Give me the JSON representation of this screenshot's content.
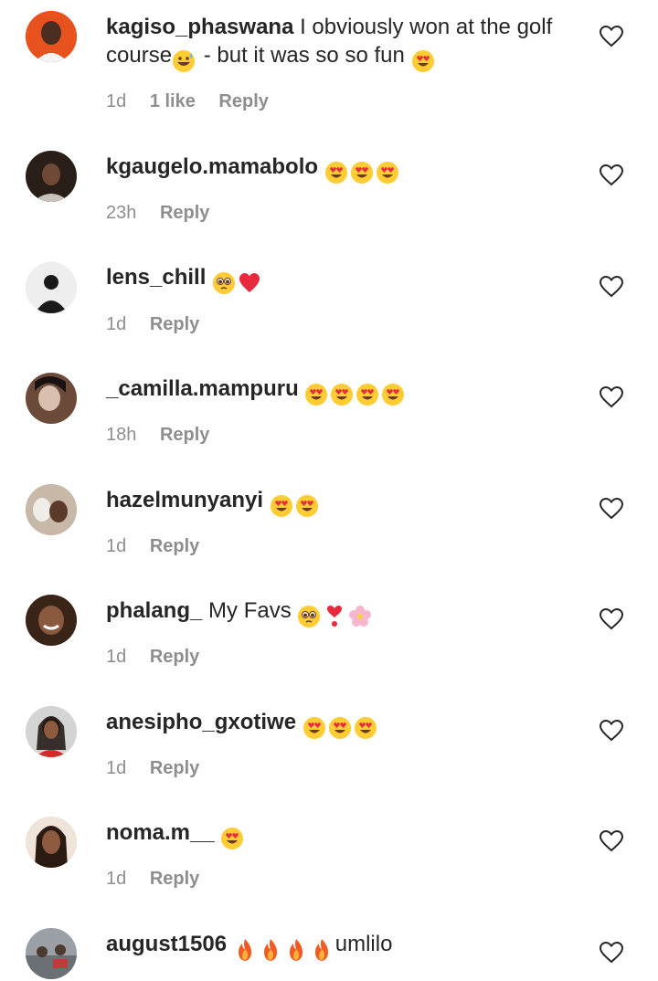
{
  "comments": [
    {
      "username": "kagiso_phaswana",
      "text_a": "I obviously won at the golf",
      "text_b": "course",
      "text_c": " - but it was so so fun",
      "time": "1d",
      "likes": "1 like",
      "reply": "Reply",
      "avatar_color": "#e8521f"
    },
    {
      "username": "kgaugelo.mamabolo",
      "text": "",
      "time": "23h",
      "reply": "Reply",
      "avatar_color": "#3a2b22"
    },
    {
      "username": "lens_chill",
      "text": "",
      "time": "1d",
      "reply": "Reply",
      "avatar_color": "#e8e8e8"
    },
    {
      "username": "_camilla.mampuru",
      "text": "",
      "time": "18h",
      "reply": "Reply",
      "avatar_color": "#6b4a3a"
    },
    {
      "username": "hazelmunyanyi",
      "text": "",
      "time": "1d",
      "reply": "Reply",
      "avatar_color": "#8a6a55"
    },
    {
      "username": "phalang_",
      "text": "My Favs",
      "time": "1d",
      "reply": "Reply",
      "avatar_color": "#5a3a2a"
    },
    {
      "username": "anesipho_gxotiwe",
      "text": "",
      "time": "1d",
      "reply": "Reply",
      "avatar_color": "#c0c0c0"
    },
    {
      "username": "noma.m__",
      "text": "",
      "time": "1d",
      "reply": "Reply",
      "avatar_color": "#d7b9a4"
    },
    {
      "username": "august1506",
      "text": "umlilo",
      "time": "",
      "reply": "",
      "avatar_color": "#9aa0a6"
    }
  ]
}
